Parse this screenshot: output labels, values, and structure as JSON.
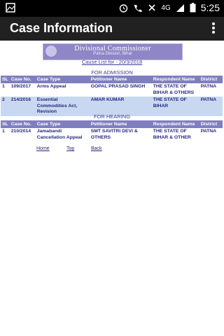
{
  "statusbar": {
    "network": "4G",
    "time": "5:25"
  },
  "appbar": {
    "title": "Case Information"
  },
  "banner": {
    "title": "Divisional Commissioner",
    "subtitle": "Patna Division, Bihar"
  },
  "cause_list_link": "Cause List for - 20/3/2018",
  "admission": {
    "heading": "FOR ADMISSION",
    "columns": [
      "SL",
      "Case No.",
      "Case Type",
      "Petitioner Name",
      "Respondent Name",
      "District"
    ],
    "rows": [
      [
        "1",
        "109/2017",
        "Arms Appeal",
        "GOPAL PRASAD SINGH",
        "THE STATE OF BIHAR & OTHERS",
        "PATNA"
      ],
      [
        "2",
        "214/2016",
        "Essential Commodities Act, Revision",
        "AMAR KUMAR",
        "THE STATE OF BIHAR",
        "PATNA"
      ]
    ]
  },
  "hearing": {
    "heading": "FOR HEARING",
    "columns": [
      "SL",
      "Case No.",
      "Case Type",
      "Petitioner Name",
      "Respondent Name",
      "District"
    ],
    "rows": [
      [
        "1",
        "210/2014",
        "Jamabandi Cancellation Appeal",
        "SMT SAVITRI DEVI & OTHERS",
        "THE STATE OF BIHAR & OTHER",
        "PATNA"
      ]
    ]
  },
  "nav": {
    "home": "Home",
    "top": "Top",
    "back": "Back"
  }
}
